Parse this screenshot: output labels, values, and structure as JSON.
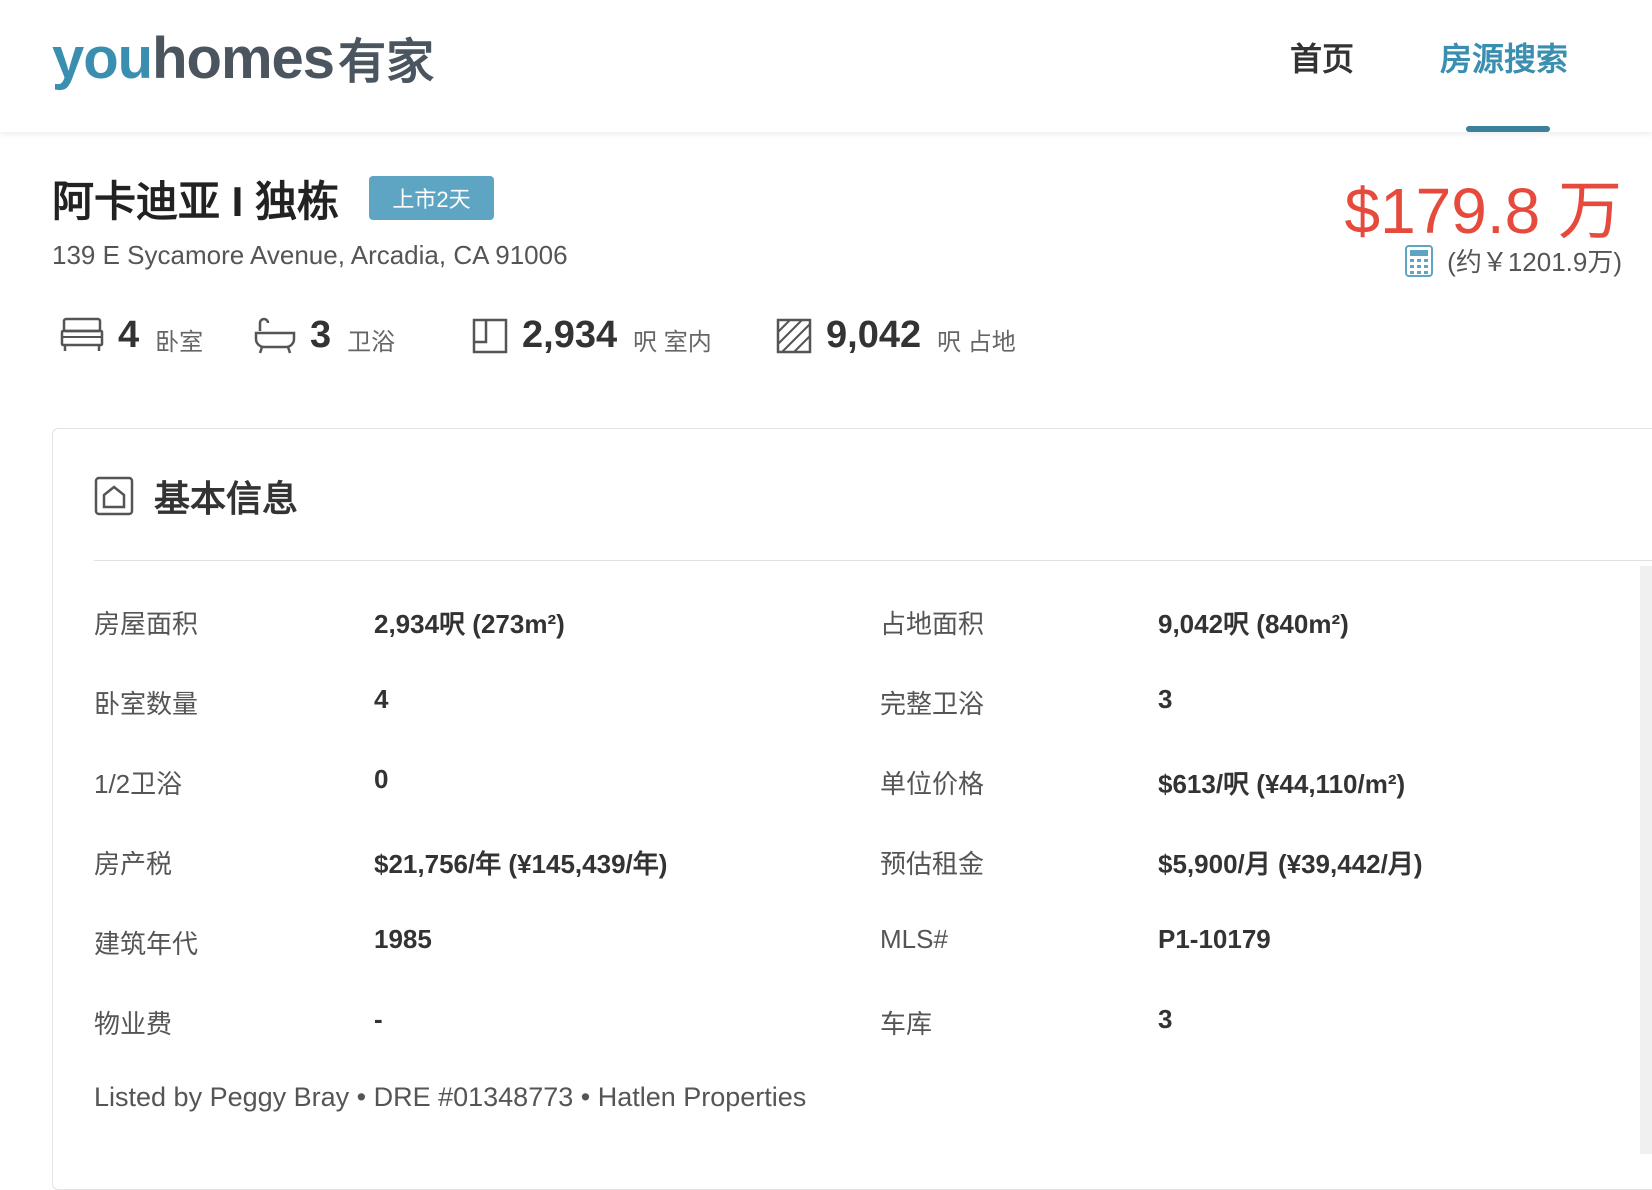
{
  "header": {
    "logo": {
      "you": "you",
      "homes": "homes",
      "cn": "有家"
    },
    "nav": {
      "home": "首页",
      "search": "房源搜索"
    },
    "active_nav": "search"
  },
  "listing": {
    "title": "阿卡迪亚 I 独栋",
    "badge": "上市2天",
    "address": "139 E Sycamore Avenue, Arcadia, CA 91006",
    "price": "$179.8 万",
    "price_cny": "(约￥1201.9万)"
  },
  "stats": {
    "bedrooms": {
      "value": "4",
      "unit": "卧室"
    },
    "bathrooms": {
      "value": "3",
      "unit": "卫浴"
    },
    "interior": {
      "value": "2,934",
      "unit": "呎 室内"
    },
    "lot": {
      "value": "9,042",
      "unit": "呎 占地"
    }
  },
  "basic_info": {
    "title": "基本信息",
    "rows": [
      {
        "l_label": "房屋面积",
        "l_value": "2,934呎 (273m²)",
        "r_label": "占地面积",
        "r_value": "9,042呎 (840m²)"
      },
      {
        "l_label": "卧室数量",
        "l_value": "4",
        "r_label": "完整卫浴",
        "r_value": "3"
      },
      {
        "l_label": "1/2卫浴",
        "l_value": "0",
        "r_label": "单位价格",
        "r_value": "$613/呎 (¥44,110/m²)"
      },
      {
        "l_label": "房产税",
        "l_value": "$21,756/年 (¥145,439/年)",
        "r_label": "预估租金",
        "r_value": "$5,900/月 (¥39,442/月)"
      },
      {
        "l_label": "建筑年代",
        "l_value": "1985",
        "r_label": "MLS#",
        "r_value": "P1-10179"
      },
      {
        "l_label": "物业费",
        "l_value": "-",
        "r_label": "车库",
        "r_value": "3"
      }
    ],
    "listed_by": "Listed by Peggy Bray • DRE #01348773 • Hatlen Properties"
  },
  "colors": {
    "brand_blue": "#3a8fb0",
    "price_red": "#e64a3c",
    "badge_blue": "#5ea5c4"
  }
}
